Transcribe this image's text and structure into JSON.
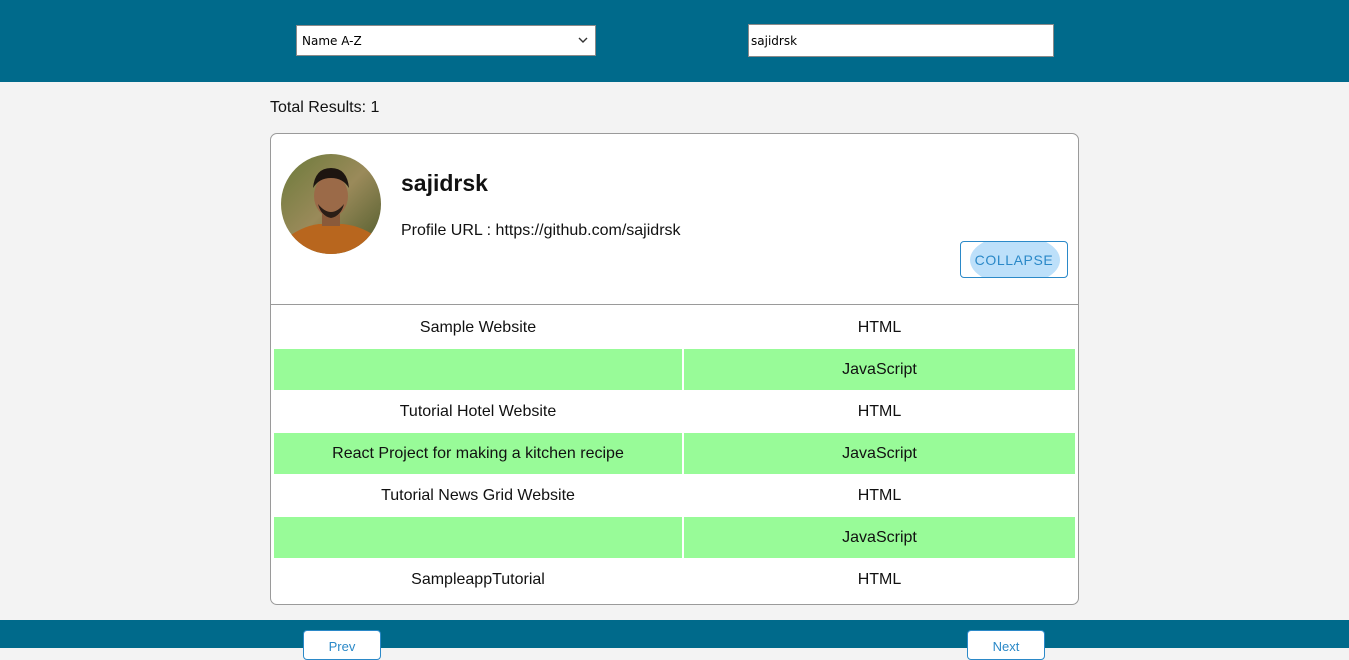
{
  "header": {
    "sort": {
      "selected": "Name A-Z"
    },
    "search": {
      "value": "sajidrsk"
    }
  },
  "results": {
    "total_label": "Total Results: 1"
  },
  "profile": {
    "username": "sajidrsk",
    "url_label": "Profile URL : https://github.com/sajidrsk",
    "collapse_label": "COLLAPSE"
  },
  "repos": [
    {
      "name": "Sample Website",
      "language": "HTML"
    },
    {
      "name": "",
      "language": "JavaScript"
    },
    {
      "name": "Tutorial Hotel Website",
      "language": "HTML"
    },
    {
      "name": "React Project for making a kitchen recipe",
      "language": "JavaScript"
    },
    {
      "name": "Tutorial News Grid Website",
      "language": "HTML"
    },
    {
      "name": "",
      "language": "JavaScript"
    },
    {
      "name": "SampleappTutorial",
      "language": "HTML"
    }
  ],
  "pagination": {
    "prev_label": "Prev",
    "next_label": "Next"
  },
  "colors": {
    "header_bg": "#006a8b",
    "accent": "#2b89c8",
    "row_highlight": "#98fb98",
    "page_bg": "#f3f3f3"
  }
}
